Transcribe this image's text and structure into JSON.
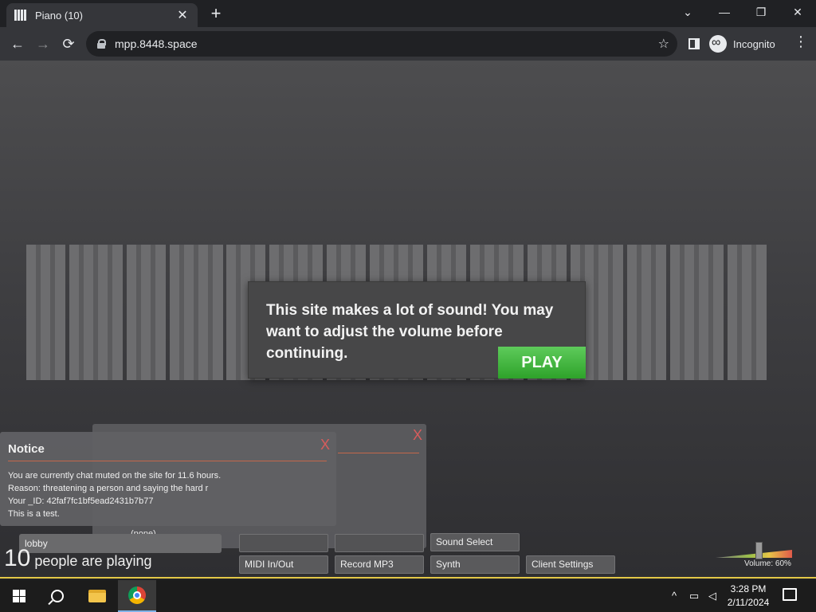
{
  "browser": {
    "tab_title": "Piano (10)",
    "tab_close": "✕",
    "new_tab": "+",
    "url": "mpp.8448.space",
    "profile_label": "Incognito",
    "controls": {
      "tablist": "⌄",
      "minimize": "—",
      "restore": "❐",
      "close": "✕"
    },
    "nav": {
      "back": "←",
      "forward": "→",
      "reload": "⟳",
      "star": "☆",
      "menu": "⋮"
    }
  },
  "modal": {
    "message": "This site makes a lot of sound! You may want to adjust the volume before continuing.",
    "play_label": "PLAY"
  },
  "notice": {
    "title": "Notice",
    "close_label": "X",
    "lines": [
      "You are currently chat muted on the site for 11.6 hours.",
      "Reason: threatening a person and saying the hard r",
      "Your _ID: 42faf7fc1bf5ead2431b7b77",
      "This is a test."
    ]
  },
  "back_panel": {
    "close_label": "X",
    "none_label": "(none)"
  },
  "room": {
    "name": "lobby",
    "count": "10",
    "people_text": "people are playing"
  },
  "buttons": {
    "sound_select": "Sound Select",
    "midi": "MIDI In/Out",
    "record": "Record MP3",
    "synth": "Synth",
    "client_settings": "Client Settings"
  },
  "volume": {
    "label": "Volume: 60%",
    "level": 0.6
  },
  "taskbar": {
    "time": "3:28 PM",
    "date": "2/11/2024",
    "tray_chevron": "^"
  }
}
